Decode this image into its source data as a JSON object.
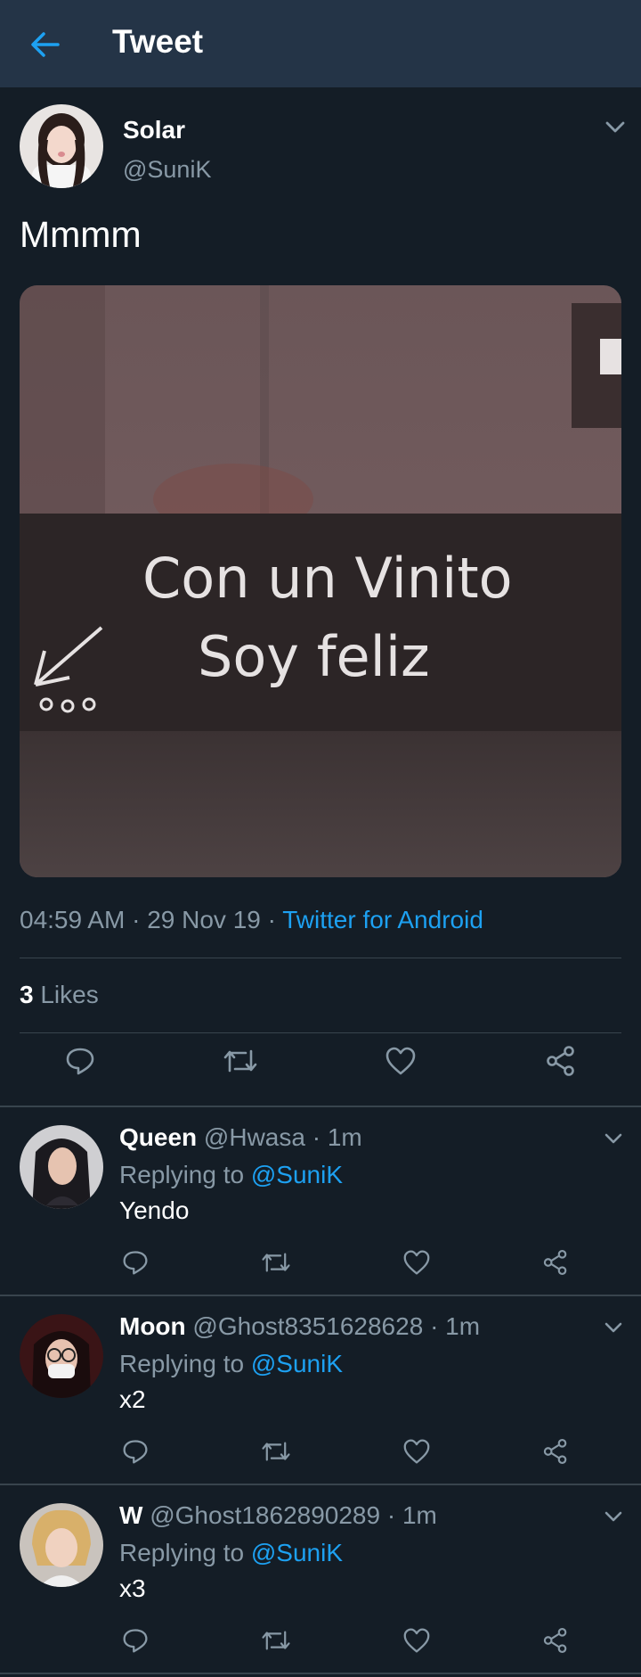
{
  "header": {
    "title": "Tweet"
  },
  "tweet": {
    "name": "Solar",
    "handle": "@SuniK",
    "text": "Mmmm",
    "image_text": [
      "Con un Vinito",
      "Soy feliz"
    ],
    "time": "04:59 AM",
    "date": "29 Nov 19",
    "source": "Twitter for Android",
    "sep": "·",
    "likes_count": "3",
    "likes_label": "Likes"
  },
  "replies": [
    {
      "name": "Queen",
      "handle": "@Hwasa",
      "time": "1m",
      "replying_label": "Replying to",
      "mention": "@SuniK",
      "text": "Yendo"
    },
    {
      "name": "Moon",
      "handle": "@Ghost8351628628",
      "time": "1m",
      "replying_label": "Replying to",
      "mention": "@SuniK",
      "text": "x2"
    },
    {
      "name": "W",
      "handle": "@Ghost1862890289",
      "time": "1m",
      "replying_label": "Replying to",
      "mention": "@SuniK",
      "text": "x3"
    }
  ],
  "icons": {
    "back": "arrow-left-icon",
    "menu": "chevron-down-icon",
    "reply": "comment-icon",
    "retweet": "retweet-icon",
    "like": "heart-icon",
    "share": "share-icon"
  },
  "colors": {
    "accent": "#1da1f2",
    "background": "#141d26",
    "header": "#243447",
    "muted": "#8899a6"
  }
}
